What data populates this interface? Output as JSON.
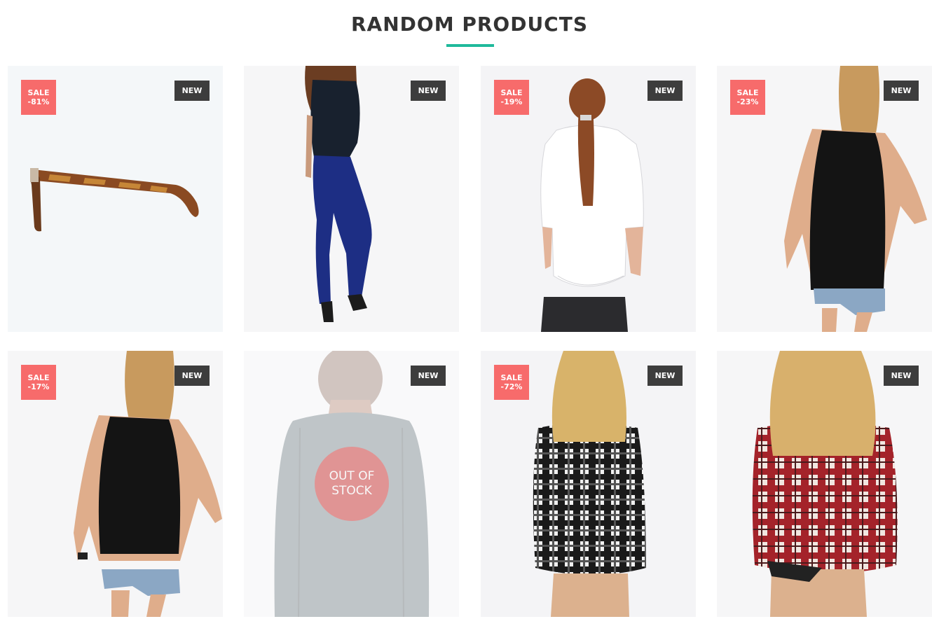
{
  "section": {
    "title": "RANDOM PRODUCTS",
    "accent_color": "#1fb99b"
  },
  "badges": {
    "new_label": "NEW",
    "sale_word": "SALE",
    "sale_color": "#f76b6b",
    "new_color": "#3d3d3d"
  },
  "products": [
    {
      "image": "tortoiseshell-glasses",
      "sale_label": "SALE",
      "discount": "-81%",
      "new": "NEW"
    },
    {
      "image": "navy-top-blue-jeans",
      "new": "NEW"
    },
    {
      "image": "white-shirt-ponytail",
      "sale_label": "SALE",
      "discount": "-19%",
      "new": "NEW"
    },
    {
      "image": "black-halter-top-shorts",
      "sale_label": "SALE",
      "discount": "-23%",
      "new": "NEW"
    },
    {
      "image": "black-halter-top-shorts-2",
      "sale_label": "SALE",
      "discount": "-17%",
      "new": "NEW"
    },
    {
      "image": "grey-blazer-tattoo",
      "new": "NEW",
      "stock_status": "OUT OF STOCK"
    },
    {
      "image": "black-white-plaid-shirt",
      "sale_label": "SALE",
      "discount": "-72%",
      "new": "NEW"
    },
    {
      "image": "red-plaid-shirt",
      "new": "NEW"
    }
  ]
}
